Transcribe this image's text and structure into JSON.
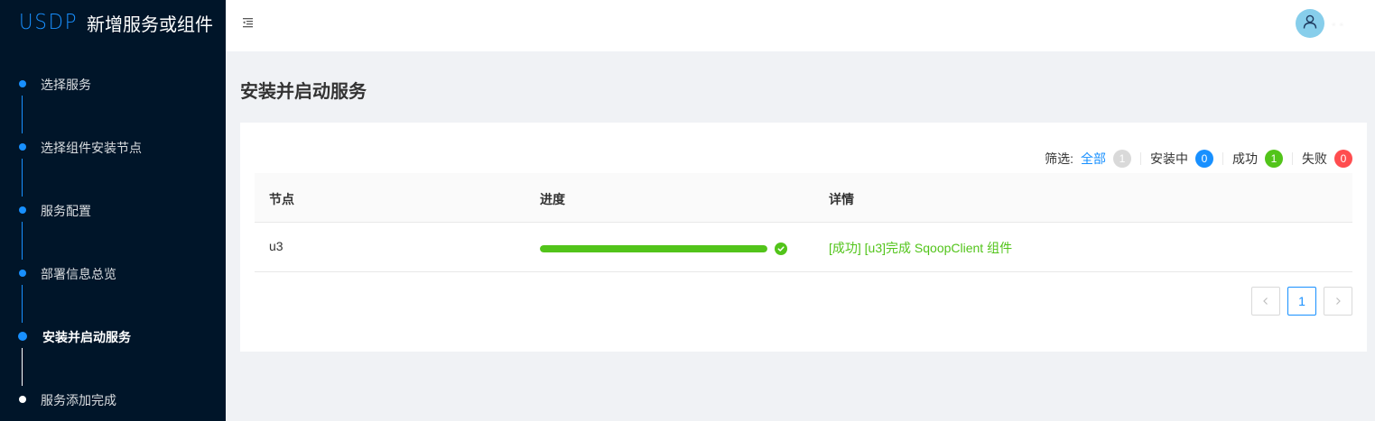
{
  "brand": {
    "logo": "USDP",
    "title": "新增服务或组件"
  },
  "steps": [
    {
      "label": "选择服务",
      "state": "done"
    },
    {
      "label": "选择组件安装节点",
      "state": "done"
    },
    {
      "label": "服务配置",
      "state": "done"
    },
    {
      "label": "部署信息总览",
      "state": "done"
    },
    {
      "label": "安装并启动服务",
      "state": "active"
    },
    {
      "label": "服务添加完成",
      "state": "pending"
    }
  ],
  "header": {
    "menu_icon": "menu-fold-icon",
    "avatar_icon": "user-icon",
    "username": "· ·"
  },
  "page": {
    "title": "安装并启动服务"
  },
  "filter": {
    "label": "筛选:",
    "items": [
      {
        "label": "全部",
        "count": "1",
        "color": "#d9d9d9",
        "selected": true
      },
      {
        "label": "安装中",
        "count": "0",
        "color": "#1890ff",
        "selected": false
      },
      {
        "label": "成功",
        "count": "1",
        "color": "#52c41a",
        "selected": false
      },
      {
        "label": "失败",
        "count": "0",
        "color": "#ff4d4f",
        "selected": false
      }
    ]
  },
  "table": {
    "columns": [
      "节点",
      "进度",
      "详情"
    ],
    "rows": [
      {
        "node": "u3",
        "progress": 100,
        "status": "success",
        "detail": "[成功] [u3]完成 SqoopClient 组件"
      }
    ]
  },
  "pagination": {
    "prev_icon": "chevron-left-icon",
    "current": "1",
    "next_icon": "chevron-right-icon"
  },
  "colors": {
    "sidebar_bg": "#001529",
    "accent": "#1890ff",
    "success": "#52c41a",
    "danger": "#ff4d4f"
  }
}
